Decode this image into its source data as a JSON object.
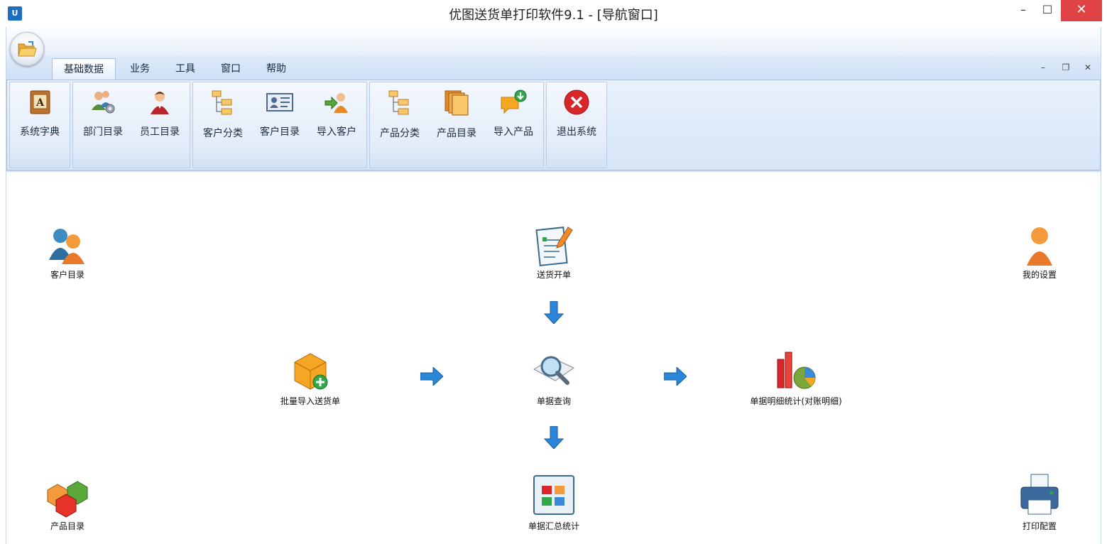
{
  "window": {
    "logo_text": "U",
    "title": "优图送货单打印软件9.1 - [导航窗口]",
    "minimize": "–",
    "maximize": "☐",
    "close": "✕"
  },
  "ribbon": {
    "tabs": [
      "基础数据",
      "业务",
      "工具",
      "窗口",
      "帮助"
    ],
    "active_tab": "基础数据",
    "mdi_controls": {
      "minimize": "–",
      "restore": "❐",
      "close": "✕"
    },
    "buttons": [
      {
        "label": "系统字典",
        "icon": "book-icon"
      },
      {
        "label": "部门目录",
        "icon": "department-users-icon"
      },
      {
        "label": "员工目录",
        "icon": "employee-icon"
      },
      {
        "label": "客户分类",
        "icon": "tree-icon"
      },
      {
        "label": "客户目录",
        "icon": "contact-card-icon"
      },
      {
        "label": "导入客户",
        "icon": "import-user-icon"
      },
      {
        "label": "产品分类",
        "icon": "tree-icon"
      },
      {
        "label": "产品目录",
        "icon": "folders-icon"
      },
      {
        "label": "导入产品",
        "icon": "import-message-icon"
      },
      {
        "label": "退出系统",
        "icon": "exit-icon"
      }
    ]
  },
  "navigation": {
    "customer_directory": "客户目录",
    "create_delivery": "送货开单",
    "my_settings": "我的设置",
    "batch_import": "批量导入送货单",
    "document_query": "单据查询",
    "document_detail_stats": "单据明细统计(对账明细)",
    "product_directory": "产品目录",
    "document_summary_stats": "单据汇总统计",
    "print_config": "打印配置"
  },
  "colors": {
    "ribbon_bg": "#dfeafa",
    "close_button": "#e04343",
    "arrow_blue": "#2a86d8"
  }
}
